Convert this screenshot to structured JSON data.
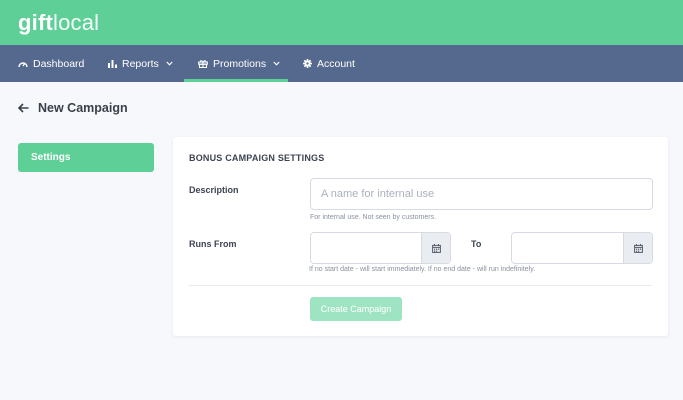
{
  "brand": {
    "bold": "gift",
    "light": "local"
  },
  "nav": {
    "items": [
      {
        "label": "Dashboard",
        "icon": "gauge-icon"
      },
      {
        "label": "Reports",
        "icon": "bar-chart-icon"
      },
      {
        "label": "Promotions",
        "icon": "gift-icon",
        "active": true
      },
      {
        "label": "Account",
        "icon": "gear-icon"
      }
    ]
  },
  "page": {
    "back_title": "New Campaign"
  },
  "sidebar": {
    "tabs": [
      {
        "label": "Settings",
        "active": true
      }
    ]
  },
  "form": {
    "section_title": "BONUS CAMPAIGN SETTINGS",
    "description": {
      "label": "Description",
      "placeholder": "A name for internal use",
      "help": "For internal use. Not seen by customers."
    },
    "runs": {
      "from_label": "Runs From",
      "to_label": "To",
      "from_value": "",
      "to_value": "",
      "help": "If no start date - will start immediately. If no end date - will run indefinitely."
    },
    "submit_label": "Create Campaign"
  },
  "colors": {
    "brand_green": "#5ecf97",
    "nav_blue": "#55698f",
    "button_disabled": "#9fe4c2"
  }
}
